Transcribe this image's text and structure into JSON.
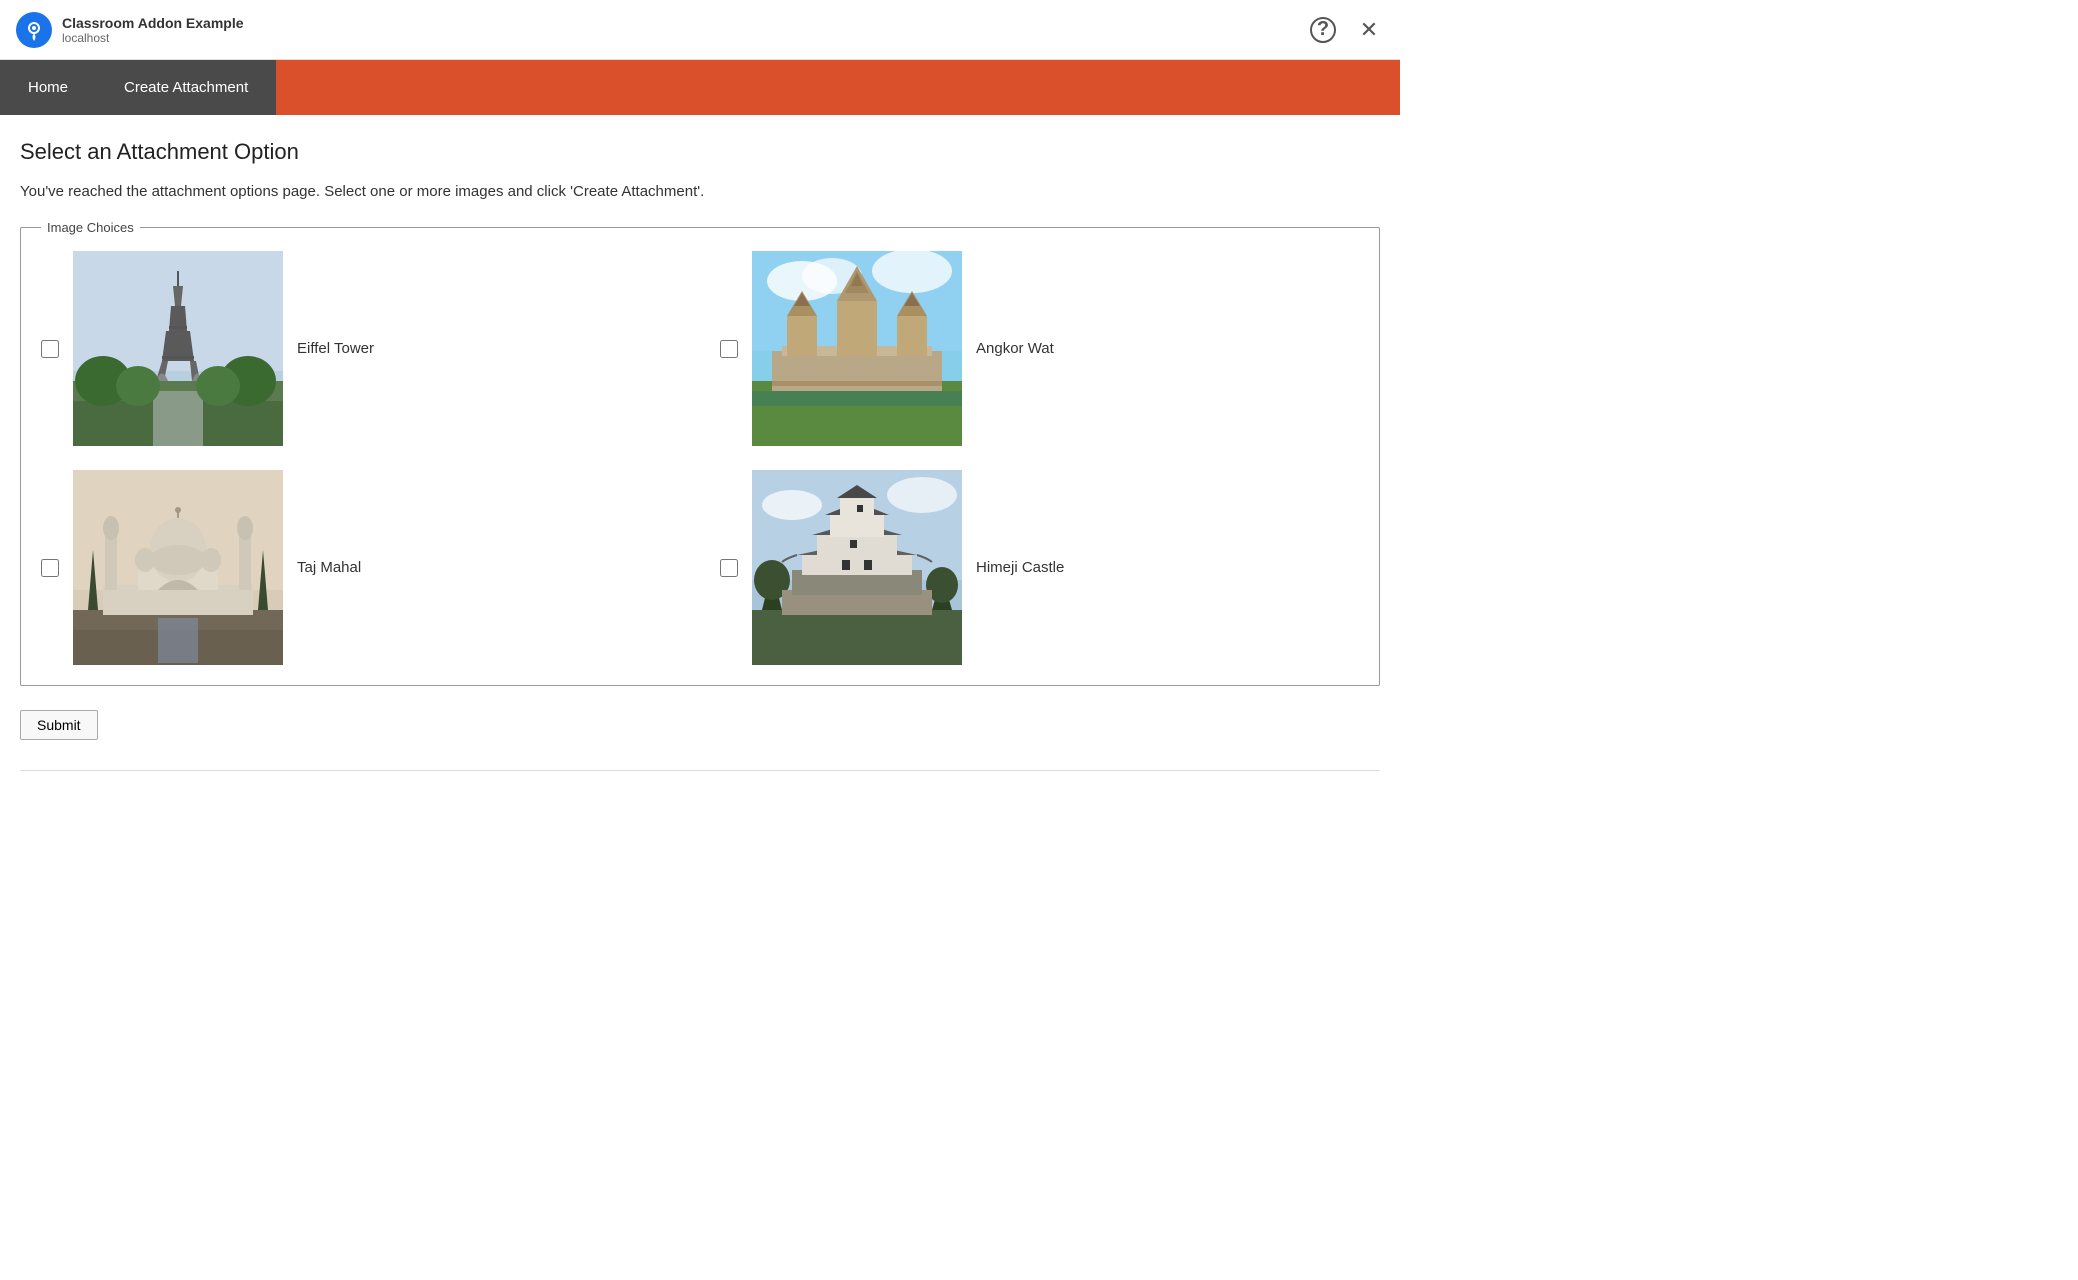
{
  "titleBar": {
    "appName": "Classroom Addon Example",
    "url": "localhost",
    "helpLabel": "?",
    "closeLabel": "×"
  },
  "nav": {
    "homeLabel": "Home",
    "createAttachmentLabel": "Create Attachment"
  },
  "main": {
    "pageTitle": "Select an Attachment Option",
    "description": "You've reached the attachment options page. Select one or more images and click 'Create Attachment'.",
    "fieldsetLegend": "Image Choices",
    "images": [
      {
        "id": "eiffel",
        "label": "Eiffel Tower"
      },
      {
        "id": "angkor",
        "label": "Angkor Wat"
      },
      {
        "id": "taj",
        "label": "Taj Mahal"
      },
      {
        "id": "himeji",
        "label": "Himeji Castle"
      }
    ],
    "submitLabel": "Submit"
  },
  "colors": {
    "navBg": "#4a4a4a",
    "accentBg": "#d9502a"
  }
}
